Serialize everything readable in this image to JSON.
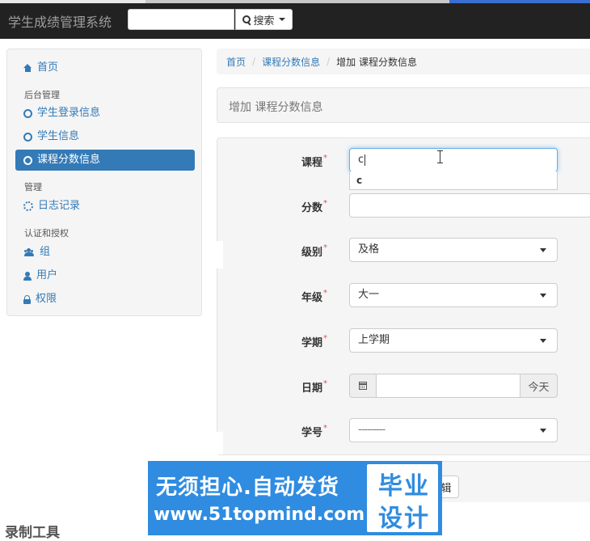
{
  "header": {
    "brand": "学生成绩管理系统",
    "search_placeholder": "",
    "search_button": "搜索"
  },
  "sidebar": {
    "home": "首页",
    "group1_header": "后台管理",
    "group1_items": [
      "学生登录信息",
      "学生信息",
      "课程分数信息"
    ],
    "group2_header": "管理",
    "group2_items": [
      "日志记录"
    ],
    "group3_header": "认证和授权",
    "group3_items": [
      "组",
      "用户",
      "权限"
    ],
    "active_item": "课程分数信息"
  },
  "breadcrumb": {
    "home": "首页",
    "section": "课程分数信息",
    "current": "增加 课程分数信息"
  },
  "panel": {
    "title": "增加 课程分数信息"
  },
  "form": {
    "course": {
      "label": "课程",
      "value": "c",
      "suggestion": "c"
    },
    "score": {
      "label": "分数",
      "value": ""
    },
    "level": {
      "label": "级别",
      "value": "及格"
    },
    "grade": {
      "label": "年级",
      "value": "大一"
    },
    "term": {
      "label": "学期",
      "value": "上学期"
    },
    "date": {
      "label": "日期",
      "value": "",
      "today": "今天"
    },
    "student_id": {
      "label": "学号",
      "value": "---------"
    },
    "required_mark": "*"
  },
  "footer": {
    "partial_button": "辑"
  },
  "overlay": {
    "line1": "无须担心.自动发货",
    "line2": "www.51topmind.com",
    "box_line1": "毕业",
    "box_line2": "设计"
  },
  "recorder_tag": "录制工具"
}
